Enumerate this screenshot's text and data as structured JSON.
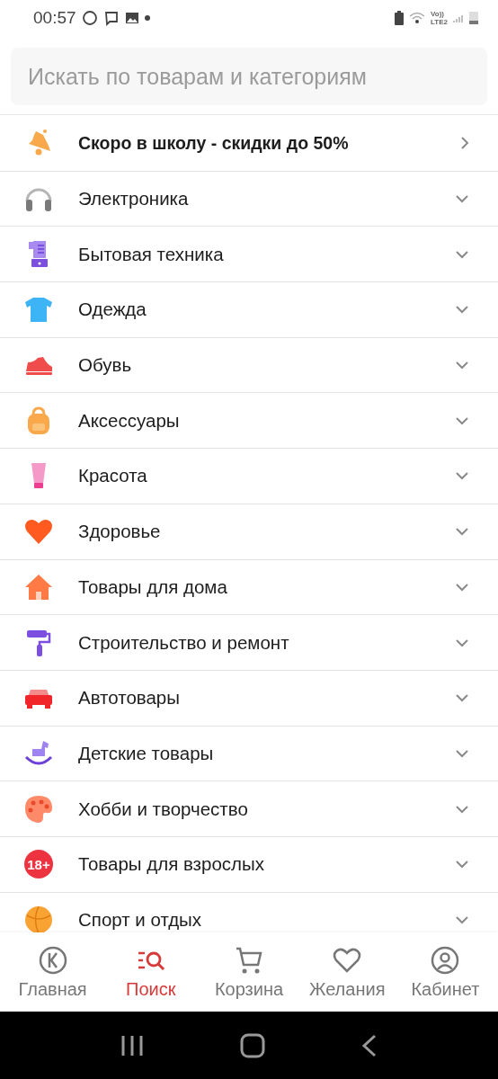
{
  "status_bar": {
    "time": "00:57",
    "network_labels": [
      "Vo))",
      "LTE2"
    ]
  },
  "search": {
    "placeholder": "Искать по товарам и категориям"
  },
  "categories": [
    {
      "kind": "promo",
      "label": "Скоро в школу - скидки до 50%"
    },
    {
      "kind": "category",
      "label": "Электроника"
    },
    {
      "kind": "category",
      "label": "Бытовая техника"
    },
    {
      "kind": "category",
      "label": "Одежда"
    },
    {
      "kind": "category",
      "label": "Обувь"
    },
    {
      "kind": "category",
      "label": "Аксессуары"
    },
    {
      "kind": "category",
      "label": "Красота"
    },
    {
      "kind": "category",
      "label": "Здоровье"
    },
    {
      "kind": "category",
      "label": "Товары для дома"
    },
    {
      "kind": "category",
      "label": "Строительство и ремонт"
    },
    {
      "kind": "category",
      "label": "Автотовары"
    },
    {
      "kind": "category",
      "label": "Детские товары"
    },
    {
      "kind": "category",
      "label": "Хобби и творчество"
    },
    {
      "kind": "category",
      "icon_text": "18+",
      "label": "Товары для взрослых"
    },
    {
      "kind": "category",
      "label": "Спорт и отдых"
    }
  ],
  "bottom_nav": [
    {
      "label": "Главная",
      "selected": false
    },
    {
      "label": "Поиск",
      "selected": true
    },
    {
      "label": "Корзина",
      "selected": false
    },
    {
      "label": "Желания",
      "selected": false
    },
    {
      "label": "Кабинет",
      "selected": false
    }
  ]
}
